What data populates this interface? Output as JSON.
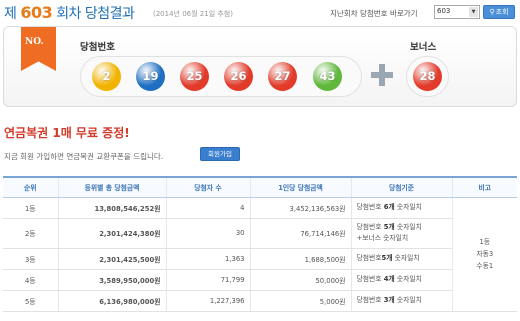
{
  "header": {
    "title_prefix": "제",
    "draw_no": "603",
    "title_suffix": "회차 당첨결과",
    "date": "(2014년 06월 21일 추첨)",
    "go_label": "지난회차 당첨번호 바로가기",
    "select_value": "603",
    "search_button": "조회"
  },
  "panel": {
    "ribbon": "NO.",
    "winning_label": "당첨번호",
    "bonus_label": "보너스",
    "balls": [
      {
        "num": "2",
        "color": "#f2b300"
      },
      {
        "num": "19",
        "color": "#1e6fc2"
      },
      {
        "num": "25",
        "color": "#e23b2a"
      },
      {
        "num": "26",
        "color": "#e23b2a"
      },
      {
        "num": "27",
        "color": "#e23b2a"
      },
      {
        "num": "43",
        "color": "#5fb83a"
      }
    ],
    "bonus_ball": {
      "num": "28",
      "color": "#e23b2a"
    }
  },
  "promo": {
    "title": "연금복권 1매 무료 증정!",
    "desc": "지금 회원 가입하면 연금복권 교환쿠폰을 드립니다.",
    "button": "회원가입"
  },
  "table": {
    "headers": [
      "순위",
      "등위별 총 당첨금액",
      "당첨자 수",
      "1인당 당첨금액",
      "당첨기준",
      "비고"
    ],
    "rows": [
      {
        "rank": "1등",
        "total": "13,808,546,252원",
        "winners": "4",
        "per": "3,452,136,563원",
        "crit_pre": "당첨번호 ",
        "crit_bold": "6개",
        "crit_post": " 숫자일치",
        "crit2": ""
      },
      {
        "rank": "2등",
        "total": "2,301,424,380원",
        "winners": "30",
        "per": "76,714,146원",
        "crit_pre": "당첨번호 ",
        "crit_bold": "5개",
        "crit_post": " 숫자일치",
        "crit2": "+보너스 숫자일치"
      },
      {
        "rank": "3등",
        "total": "2,301,425,500원",
        "winners": "1,363",
        "per": "1,688,500원",
        "crit_pre": "당첨번호",
        "crit_bold": "5개",
        "crit_post": " 숫자일치",
        "crit2": ""
      },
      {
        "rank": "4등",
        "total": "3,589,950,000원",
        "winners": "71,799",
        "per": "50,000원",
        "crit_pre": "당첨번호 ",
        "crit_bold": "4개",
        "crit_post": " 숫자일치",
        "crit2": ""
      },
      {
        "rank": "5등",
        "total": "6,136,980,000원",
        "winners": "1,227,396",
        "per": "5,000원",
        "crit_pre": "당첨번호 ",
        "crit_bold": "3개",
        "crit_post": " 숫자일치",
        "crit2": ""
      }
    ],
    "note_lines": [
      "1등",
      "자동3",
      "수동1"
    ]
  }
}
